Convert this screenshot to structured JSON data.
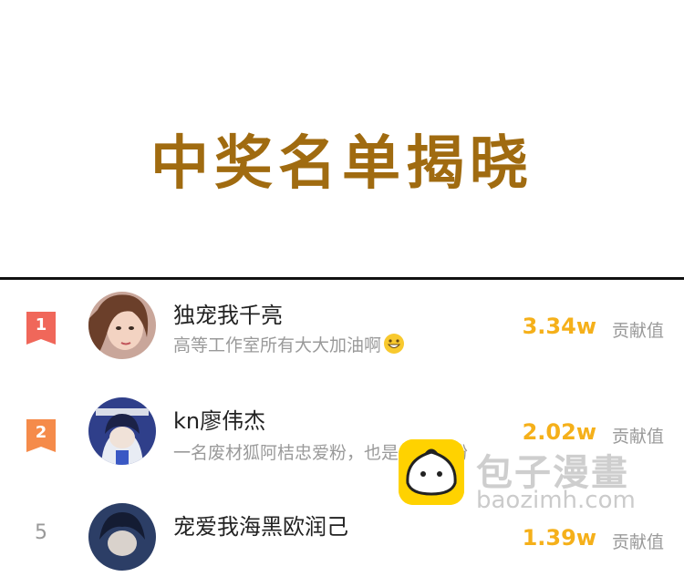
{
  "banner": {
    "title": "中奖名单揭晓"
  },
  "list": [
    {
      "rank": "1",
      "name": "独宠我千亮",
      "comment": "高等工作室所有大大加油啊",
      "emoji": "grin-emoji",
      "score": "3.34w",
      "score_label": "贡献值",
      "badge_color": "#f0675a"
    },
    {
      "rank": "2",
      "name": "kn廖伟杰",
      "comment": "一名废材狐阿桔忠爱粉，也是一名梅粉",
      "score": "2.02w",
      "score_label": "贡献值",
      "badge_color": "#f58b4a"
    },
    {
      "rank": "5",
      "name": "宠爱我海黑欧润己",
      "score": "1.39w",
      "score_label": "贡献值"
    }
  ],
  "watermark": {
    "name": "包子漫畫",
    "url": "baozimh.com",
    "logo_color": "#ffd200"
  }
}
